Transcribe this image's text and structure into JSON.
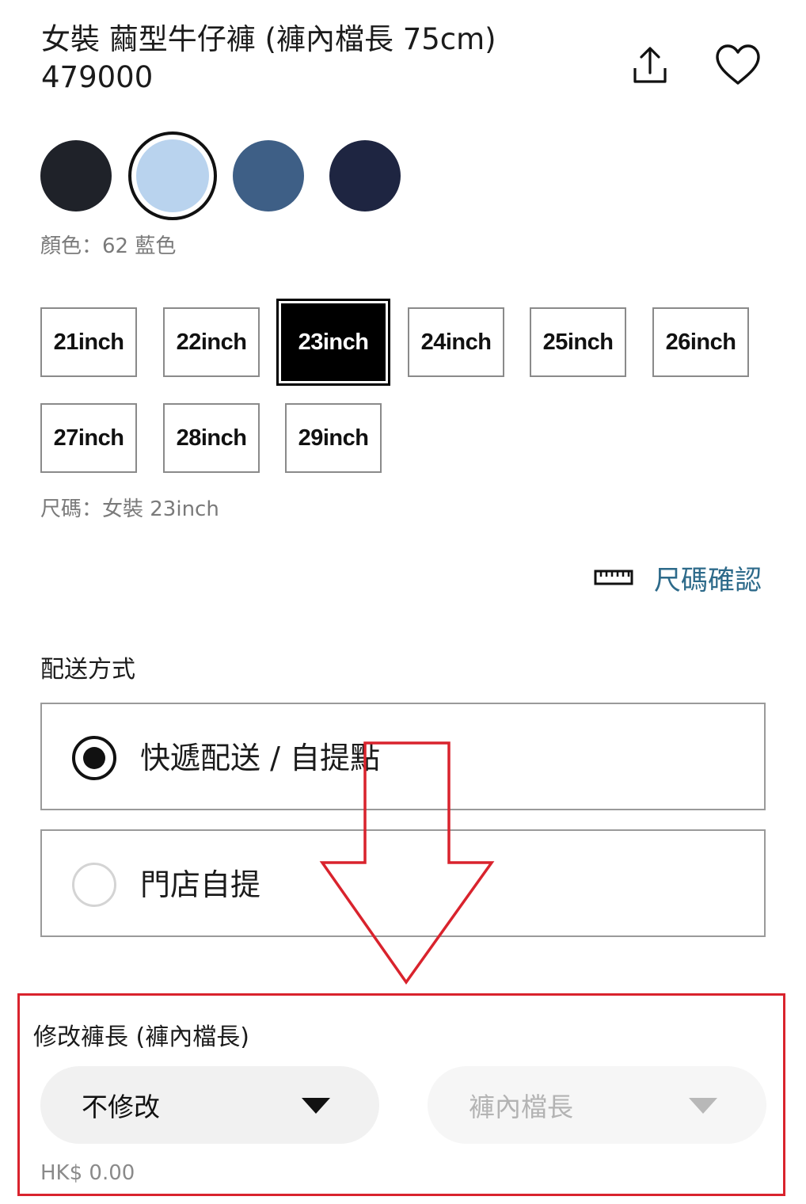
{
  "product": {
    "title": "女裝 繭型牛仔褲 (褲內檔長 75cm)",
    "code": "479000"
  },
  "icons": {
    "share": "share-icon",
    "favorite": "heart-icon",
    "ruler": "ruler-icon",
    "dropdown": "caret-down-icon"
  },
  "colors": {
    "swatches": [
      "#1f2229",
      "#b9d3ee",
      "#3e5f86",
      "#1e2541"
    ],
    "selected_index": 1,
    "caption": "顏色：62 藍色",
    "accent": "#2d6a8a",
    "annotation_red": "#d9232d"
  },
  "sizes": {
    "options": [
      "21inch",
      "22inch",
      "23inch",
      "24inch",
      "25inch",
      "26inch",
      "27inch",
      "28inch",
      "29inch"
    ],
    "selected": "23inch",
    "caption": "尺碼：女裝 23inch",
    "size_check_link": "尺碼確認"
  },
  "delivery": {
    "heading": "配送方式",
    "options": [
      {
        "label": "快遞配送 / 自提點",
        "selected": true
      },
      {
        "label": "門店自提",
        "selected": false
      }
    ]
  },
  "alteration": {
    "heading": "修改褲長 (褲內檔長)",
    "length_select_value": "不修改",
    "inseam_select_placeholder": "褲內檔長",
    "price": "HK$ 0.00"
  }
}
